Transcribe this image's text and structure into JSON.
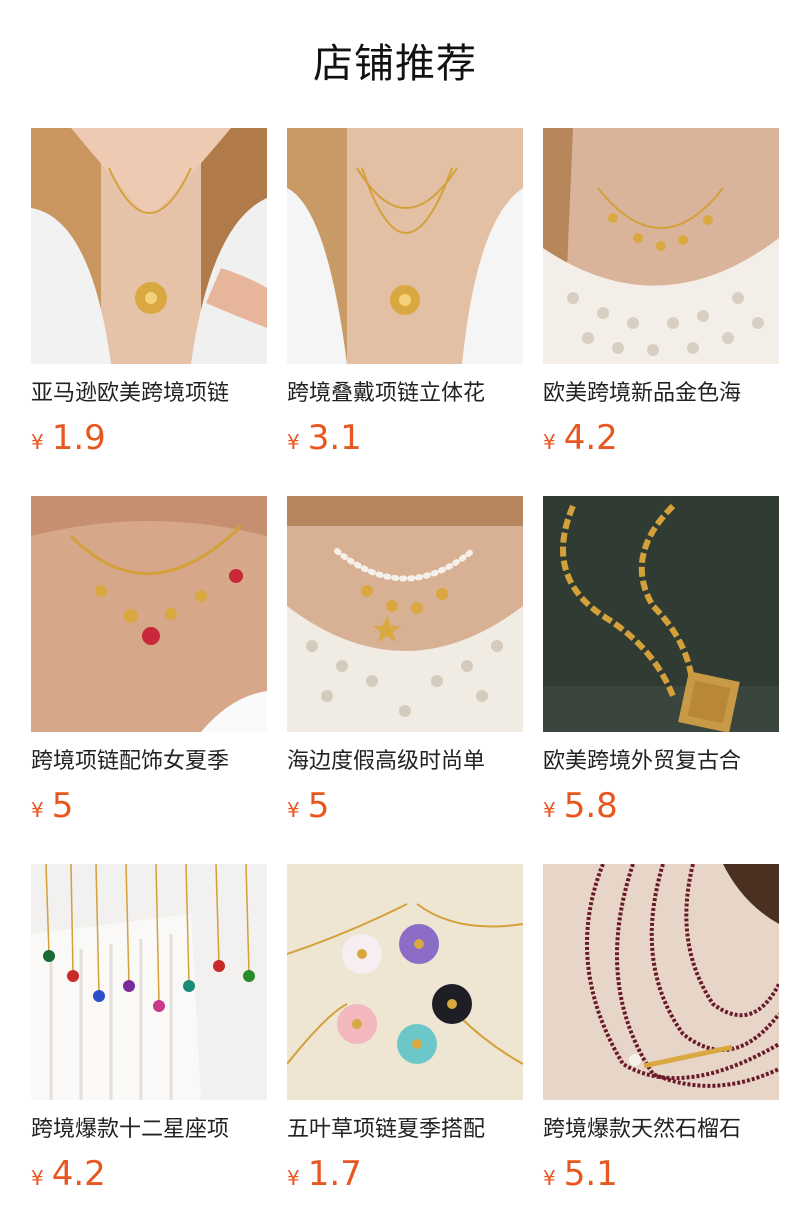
{
  "header": {
    "title": "店铺推荐"
  },
  "currency_symbol": "¥",
  "products": [
    {
      "name": "亚马逊欧美跨境项链",
      "price": "1.9"
    },
    {
      "name": "跨境叠戴项链立体花",
      "price": "3.1"
    },
    {
      "name": "欧美跨境新品金色海",
      "price": "4.2"
    },
    {
      "name": "跨境项链配饰女夏季",
      "price": "5"
    },
    {
      "name": "海边度假高级时尚单",
      "price": "5"
    },
    {
      "name": "欧美跨境外贸复古合",
      "price": "5.8"
    },
    {
      "name": "跨境爆款十二星座项",
      "price": "4.2"
    },
    {
      "name": "五叶草项链夏季搭配",
      "price": "1.7"
    },
    {
      "name": "跨境爆款天然石榴石",
      "price": "5.1"
    }
  ],
  "colors": {
    "price": "#e8571f",
    "title": "#111111",
    "name": "#222222"
  }
}
